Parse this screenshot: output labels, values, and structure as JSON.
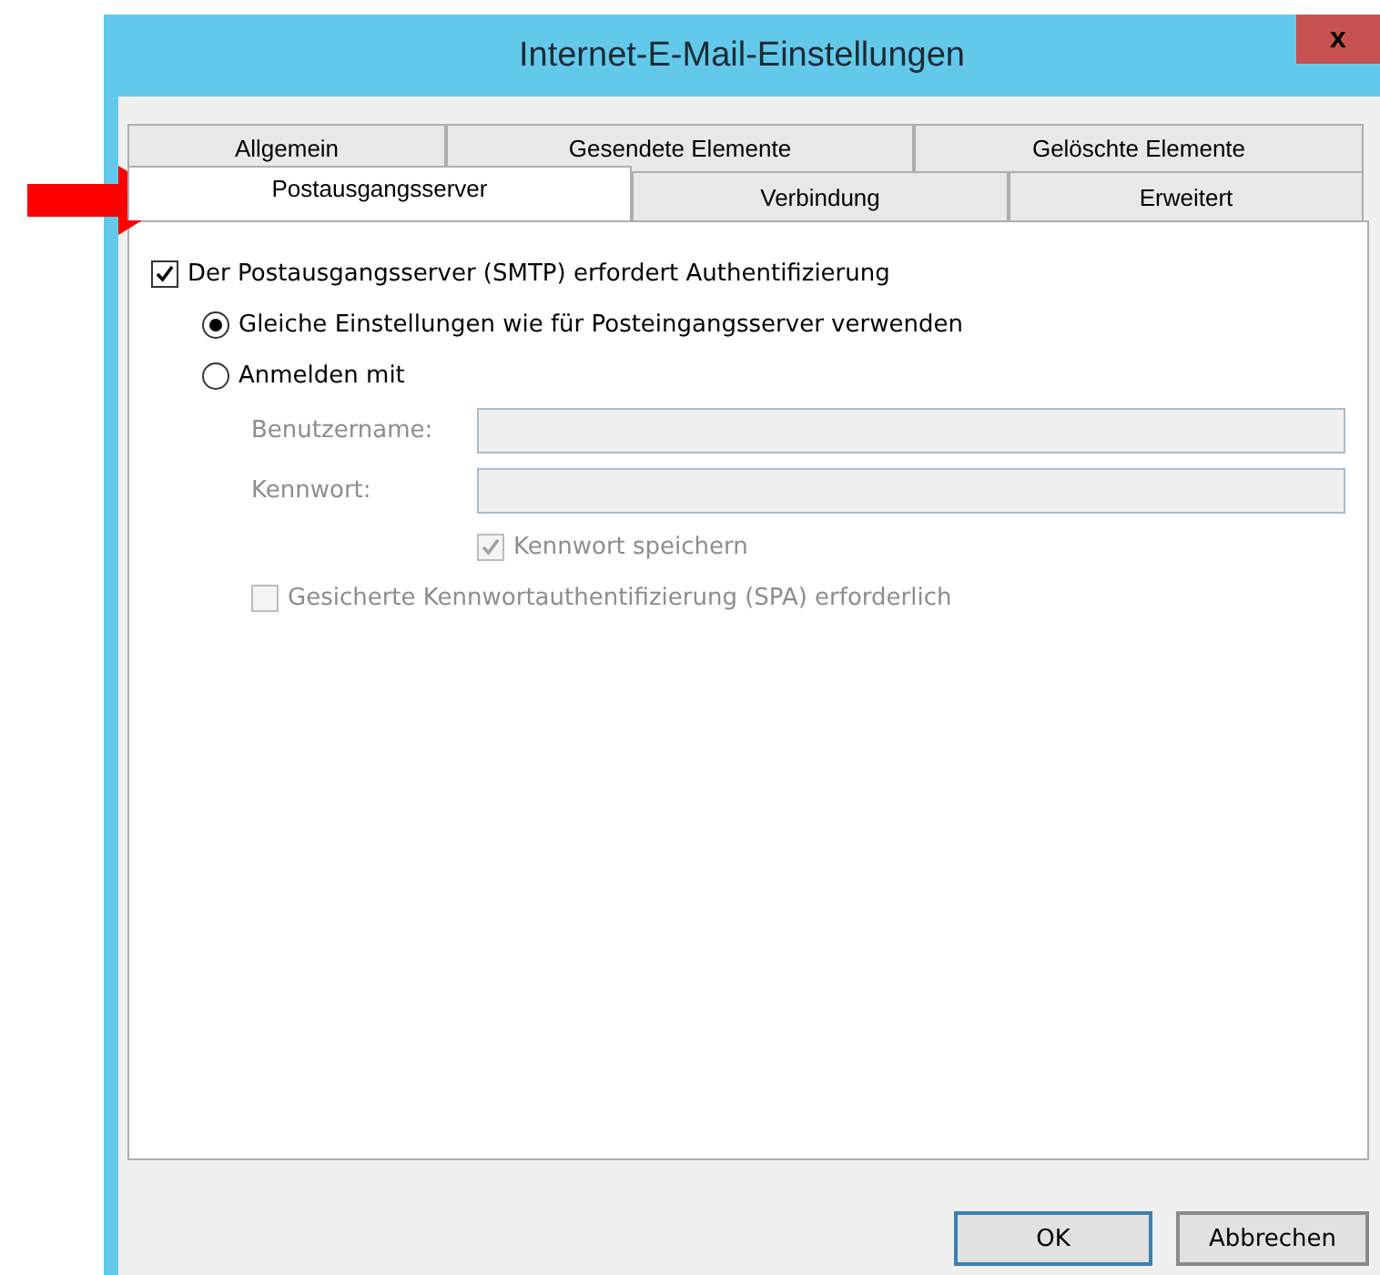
{
  "window": {
    "title": "Internet-E-Mail-Einstellungen",
    "close": "x"
  },
  "tab_rows": [
    [
      {
        "label": "Allgemein",
        "selected": false
      },
      {
        "label": "Gesendete Elemente",
        "selected": false
      },
      {
        "label": "Gelöschte Elemente",
        "selected": false
      }
    ],
    [
      {
        "label": "Postausgangsserver",
        "selected": true
      },
      {
        "label": "Verbindung",
        "selected": false
      },
      {
        "label": "Erweitert",
        "selected": false
      }
    ]
  ],
  "auth": {
    "label": "Der Postausgangsserver (SMTP) erfordert Authentifizierung",
    "checked": true
  },
  "radios": [
    {
      "label": "Gleiche Einstellungen wie für Posteingangsserver verwenden",
      "selected": true
    },
    {
      "label": "Anmelden mit",
      "selected": false
    }
  ],
  "fields": [
    {
      "label": "Benutzername:",
      "disabled": true
    },
    {
      "label": "Kennwort:",
      "disabled": true
    }
  ],
  "save_password": {
    "label": "Kennwort speichern",
    "checked": true,
    "disabled": true
  },
  "spa": {
    "label": "Gesicherte Kennwortauthentifizierung (SPA) erforderlich",
    "checked": false,
    "disabled": true
  },
  "buttons": [
    {
      "label": "OK",
      "kind": "default"
    },
    {
      "label": "Abbrechen",
      "kind": "normal"
    }
  ]
}
